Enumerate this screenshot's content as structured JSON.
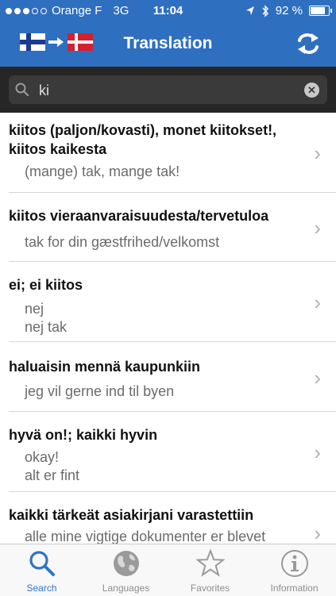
{
  "status_bar": {
    "carrier": "Orange F",
    "network": "3G",
    "time": "11:04",
    "battery": "92 %",
    "signal_bars": 3,
    "battery_level": 0.92
  },
  "nav": {
    "title": "Translation",
    "from_flag": "finland-flag-icon",
    "to_flag": "denmark-flag-icon",
    "swap_icon": "swap-icon"
  },
  "search": {
    "value": "ki",
    "placeholder": ""
  },
  "results": [
    {
      "source": "kiitos (paljon/kovasti), monet kiitokset!, kiitos kaikesta",
      "translations": [
        "(mange) tak, mange tak!"
      ]
    },
    {
      "source": "kiitos vieraanvaraisuudesta/tervetuloa",
      "translations": [
        "tak for din gæstfrihed/velkomst"
      ]
    },
    {
      "source": "ei; ei kiitos",
      "translations": [
        "nej",
        "nej tak"
      ]
    },
    {
      "source": "haluaisin mennä kaupunkiin",
      "translations": [
        "jeg vil gerne ind til byen"
      ]
    },
    {
      "source": "hyvä on!; kaikki hyvin",
      "translations": [
        "okay!",
        "alt er fint"
      ]
    },
    {
      "source": "kaikki tärkeät asiakirjani varastettiin",
      "translations": [
        "alle mine vigtige dokumenter er blevet"
      ]
    }
  ],
  "tabs": [
    {
      "label": "Search",
      "icon": "search-icon",
      "active": true
    },
    {
      "label": "Languages",
      "icon": "globe-icon",
      "active": false
    },
    {
      "label": "Favorites",
      "icon": "star-icon",
      "active": false
    },
    {
      "label": "Information",
      "icon": "info-icon",
      "active": false
    }
  ],
  "colors": {
    "nav_blue": "#2f6fc0",
    "active_tab": "#2d75c9",
    "inactive_tab": "#8e8e8e",
    "search_bg": "#262626"
  }
}
